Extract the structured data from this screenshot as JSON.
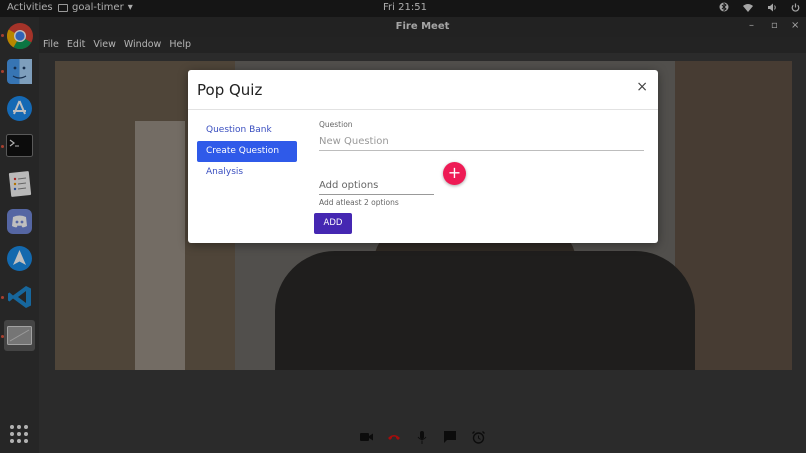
{
  "topbar": {
    "activities": "Activities",
    "app_name": "goal-timer",
    "clock": "Fri 21:51",
    "tray_arrow": "▾"
  },
  "window": {
    "title": "Fire Meet",
    "menu": [
      "File",
      "Edit",
      "View",
      "Window",
      "Help"
    ]
  },
  "dock": {
    "items": [
      "chrome-icon",
      "finder-icon",
      "app-store-icon",
      "terminal-icon",
      "notes-icon",
      "discord-icon",
      "send-icon",
      "vscode-icon",
      "window-icon"
    ],
    "accent": "#e0563f"
  },
  "modal": {
    "title": "Pop Quiz",
    "close": "×",
    "nav": [
      "Question Bank",
      "Create Question",
      "Analysis"
    ],
    "active_nav": "Create Question",
    "question_label": "Question",
    "question_placeholder": "New Question",
    "options_placeholder": "Add options",
    "options_hint": "Add atleast 2 options",
    "fab_label": "+",
    "add_label": "ADD",
    "colors": {
      "primary": "#2f5ae9",
      "fab": "#ee1b55",
      "button": "#4527b2"
    }
  },
  "controls": [
    "camera-icon",
    "hangup-icon",
    "mic-icon",
    "chat-icon",
    "alarm-icon"
  ]
}
